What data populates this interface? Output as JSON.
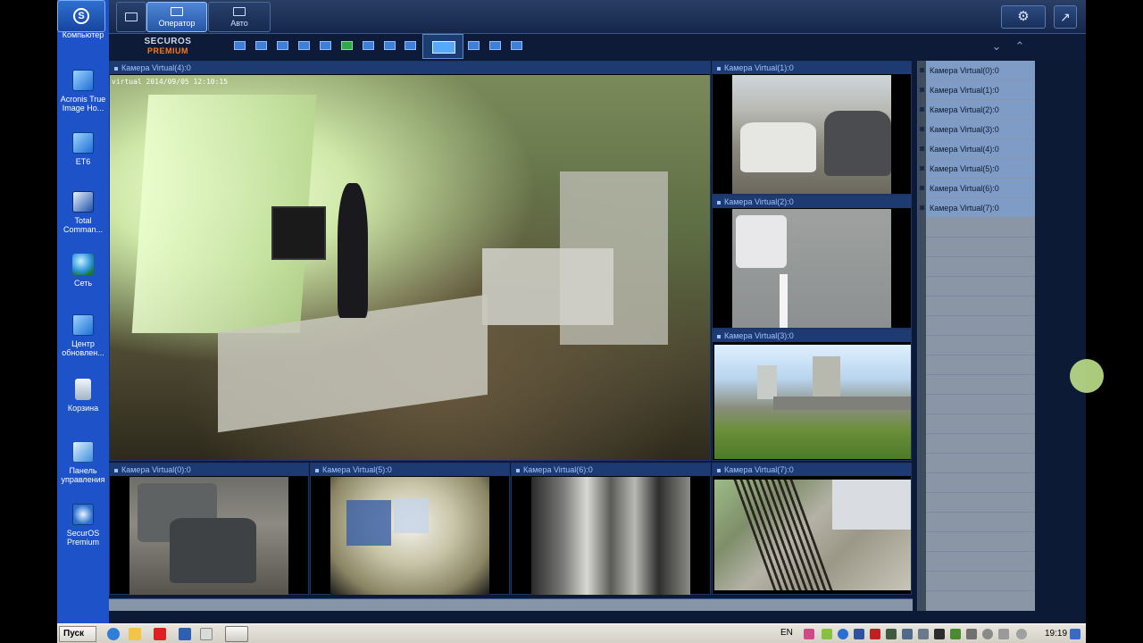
{
  "desktop": {
    "icons": [
      {
        "label": "Компьютер",
        "icon": "computer-icon"
      },
      {
        "label": "Acronis True Image Ho...",
        "icon": "acronis-icon"
      },
      {
        "label": "ET6",
        "icon": "et6-icon"
      },
      {
        "label": "Total Comman...",
        "icon": "total-commander-icon"
      },
      {
        "label": "Сеть",
        "icon": "network-icon"
      },
      {
        "label": "Центр обновлен...",
        "icon": "update-center-icon"
      },
      {
        "label": "Корзина",
        "icon": "recycle-bin-icon"
      },
      {
        "label": "Панель управления",
        "icon": "control-panel-icon"
      },
      {
        "label": "SecurOS Premium",
        "icon": "securos-icon"
      }
    ]
  },
  "app": {
    "toolbar": {
      "operator_label": "Оператор",
      "auto_label": "Авто"
    },
    "brand": {
      "line1": "SECUROS",
      "line2": "PREMIUM"
    },
    "accent": "#2657a6",
    "cameras": {
      "main": {
        "title": "Камера Virtual(4):0",
        "osd": "virtual   2014/09/05 12:10:15"
      },
      "c1": {
        "title": "Камера Virtual(1):0"
      },
      "c2": {
        "title": "Камера Virtual(2):0"
      },
      "c3": {
        "title": "Камера Virtual(3):0"
      },
      "c0": {
        "title": "Камера Virtual(0):0"
      },
      "c5": {
        "title": "Камера Virtual(5):0"
      },
      "c6": {
        "title": "Камера Virtual(6):0"
      },
      "c7": {
        "title": "Камера Virtual(7):0"
      }
    },
    "camera_list": [
      "Камера Virtual(0):0",
      "Камера Virtual(1):0",
      "Камера Virtual(2):0",
      "Камера Virtual(3):0",
      "Камера Virtual(4):0",
      "Камера Virtual(5):0",
      "Камера Virtual(6):0",
      "Камера Virtual(7):0"
    ]
  },
  "taskbar": {
    "start_label": "Пуск",
    "lang": "EN",
    "clock": "19:19"
  }
}
